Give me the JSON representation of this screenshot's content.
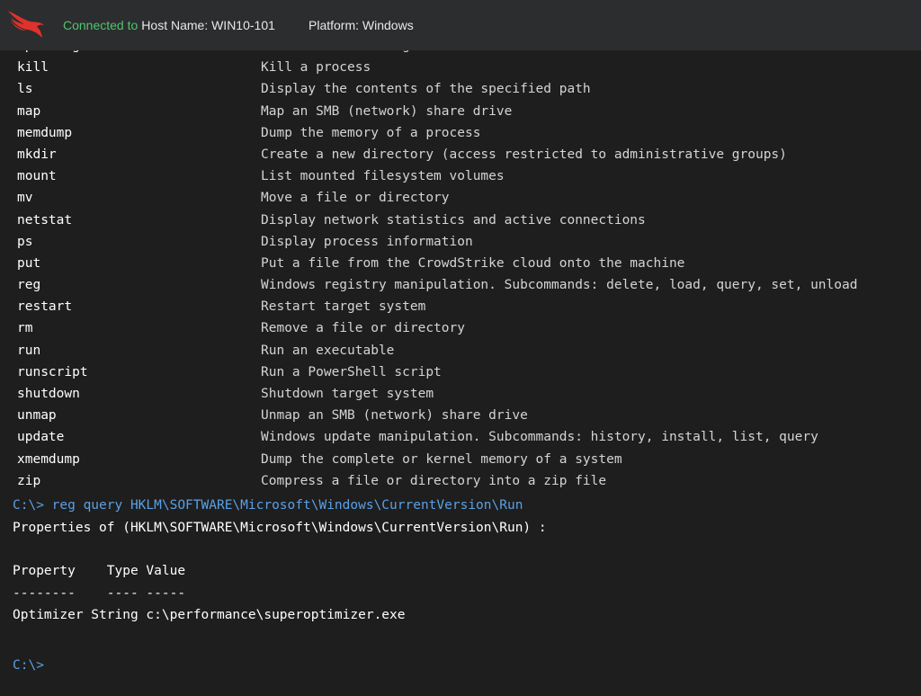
{
  "header": {
    "status": "Connected to",
    "host": "Host Name: WIN10-101",
    "platform": "Platform: Windows"
  },
  "commands": [
    {
      "name": "ipconfig",
      "desc": "Show network configuration information"
    },
    {
      "name": "kill",
      "desc": "Kill a process"
    },
    {
      "name": "ls",
      "desc": "Display the contents of the specified path"
    },
    {
      "name": "map",
      "desc": "Map an SMB (network) share drive"
    },
    {
      "name": "memdump",
      "desc": "Dump the memory of a process"
    },
    {
      "name": "mkdir",
      "desc": "Create a new directory (access restricted to administrative groups)"
    },
    {
      "name": "mount",
      "desc": "List mounted filesystem volumes"
    },
    {
      "name": "mv",
      "desc": "Move a file or directory"
    },
    {
      "name": "netstat",
      "desc": "Display network statistics and active connections"
    },
    {
      "name": "ps",
      "desc": "Display process information"
    },
    {
      "name": "put",
      "desc": "Put a file from the CrowdStrike cloud onto the machine"
    },
    {
      "name": "reg",
      "desc": "Windows registry manipulation. Subcommands: delete, load, query, set, unload"
    },
    {
      "name": "restart",
      "desc": "Restart target system"
    },
    {
      "name": "rm",
      "desc": "Remove a file or directory"
    },
    {
      "name": "run",
      "desc": "Run an executable"
    },
    {
      "name": "runscript",
      "desc": "Run a PowerShell script"
    },
    {
      "name": "shutdown",
      "desc": "Shutdown target system"
    },
    {
      "name": "unmap",
      "desc": "Unmap an SMB (network) share drive"
    },
    {
      "name": "update",
      "desc": "Windows update manipulation. Subcommands: history, install, list, query"
    },
    {
      "name": "xmemdump",
      "desc": "Dump the complete or kernel memory of a system"
    },
    {
      "name": "zip",
      "desc": "Compress a file or directory into a zip file"
    }
  ],
  "output": {
    "command": "C:\\> reg query HKLM\\SOFTWARE\\Microsoft\\Windows\\CurrentVersion\\Run",
    "properties_line": "Properties of (HKLM\\SOFTWARE\\Microsoft\\Windows\\CurrentVersion\\Run) :",
    "table_header": "Property    Type Value",
    "table_rule": "--------    ---- -----",
    "table_row": "Optimizer String c:\\performance\\superoptimizer.exe",
    "prompt": "C:\\>"
  },
  "colors": {
    "background": "#1e1e1e",
    "header_bar": "#2c2d2f",
    "connected": "#4ec66e",
    "prompt": "#5aa0e6",
    "logo": "#e0322c"
  },
  "icons": {
    "logo": "crowdstrike-falcon-logo"
  }
}
